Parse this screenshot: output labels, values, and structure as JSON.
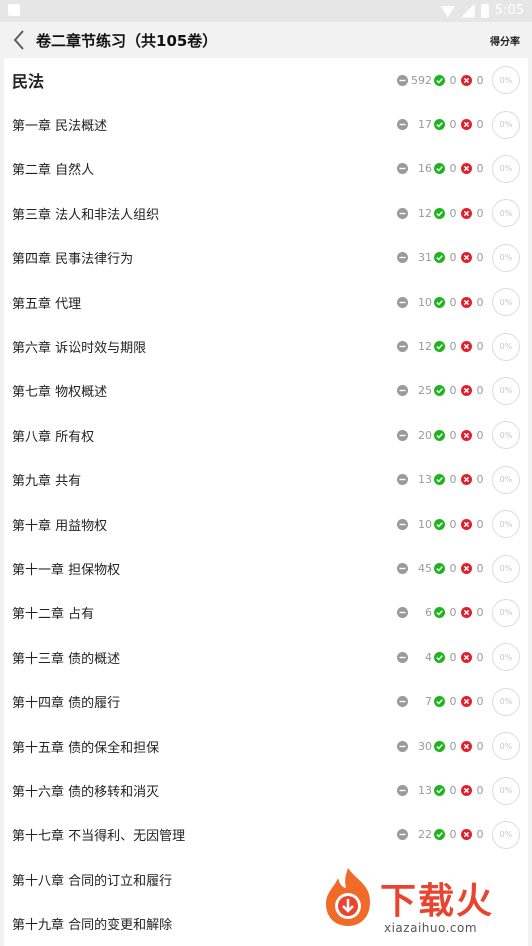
{
  "status_bar": {
    "time": "5:05"
  },
  "header": {
    "title": "卷二章节练习（共105卷）",
    "right_label": "得分率"
  },
  "rows": [
    {
      "label": "民法",
      "total": "592",
      "correct": "0",
      "wrong": "0",
      "rate": "0%"
    },
    {
      "label": "第一章 民法概述",
      "total": "17",
      "correct": "0",
      "wrong": "0",
      "rate": "0%"
    },
    {
      "label": "第二章 自然人",
      "total": "16",
      "correct": "0",
      "wrong": "0",
      "rate": "0%"
    },
    {
      "label": "第三章 法人和非法人组织",
      "total": "12",
      "correct": "0",
      "wrong": "0",
      "rate": "0%"
    },
    {
      "label": "第四章 民事法律行为",
      "total": "31",
      "correct": "0",
      "wrong": "0",
      "rate": "0%"
    },
    {
      "label": "第五章 代理",
      "total": "10",
      "correct": "0",
      "wrong": "0",
      "rate": "0%"
    },
    {
      "label": "第六章 诉讼时效与期限",
      "total": "12",
      "correct": "0",
      "wrong": "0",
      "rate": "0%"
    },
    {
      "label": "第七章 物权概述",
      "total": "25",
      "correct": "0",
      "wrong": "0",
      "rate": "0%"
    },
    {
      "label": "第八章 所有权",
      "total": "20",
      "correct": "0",
      "wrong": "0",
      "rate": "0%"
    },
    {
      "label": "第九章 共有",
      "total": "13",
      "correct": "0",
      "wrong": "0",
      "rate": "0%"
    },
    {
      "label": "第十章 用益物权",
      "total": "10",
      "correct": "0",
      "wrong": "0",
      "rate": "0%"
    },
    {
      "label": "第十一章 担保物权",
      "total": "45",
      "correct": "0",
      "wrong": "0",
      "rate": "0%"
    },
    {
      "label": "第十二章 占有",
      "total": "6",
      "correct": "0",
      "wrong": "0",
      "rate": "0%"
    },
    {
      "label": "第十三章 债的概述",
      "total": "4",
      "correct": "0",
      "wrong": "0",
      "rate": "0%"
    },
    {
      "label": "第十四章 债的履行",
      "total": "7",
      "correct": "0",
      "wrong": "0",
      "rate": "0%"
    },
    {
      "label": "第十五章 债的保全和担保",
      "total": "30",
      "correct": "0",
      "wrong": "0",
      "rate": "0%"
    },
    {
      "label": "第十六章 债的移转和消灭",
      "total": "13",
      "correct": "0",
      "wrong": "0",
      "rate": "0%"
    },
    {
      "label": "第十七章 不当得利、无因管理",
      "total": "22",
      "correct": "0",
      "wrong": "0",
      "rate": "0%"
    },
    {
      "label": "第十八章 合同的订立和履行",
      "total": "",
      "correct": "",
      "wrong": "",
      "rate": ""
    },
    {
      "label": "第十九章 合同的变更和解除",
      "total": "",
      "correct": "",
      "wrong": "",
      "rate": ""
    }
  ],
  "watermark": {
    "text": "下载火",
    "url": "xiazaihuo.com"
  },
  "colors": {
    "correct": "#1cb51c",
    "wrong": "#e0202a",
    "neutral": "#9a9a9a",
    "brand": "#e8442e"
  }
}
